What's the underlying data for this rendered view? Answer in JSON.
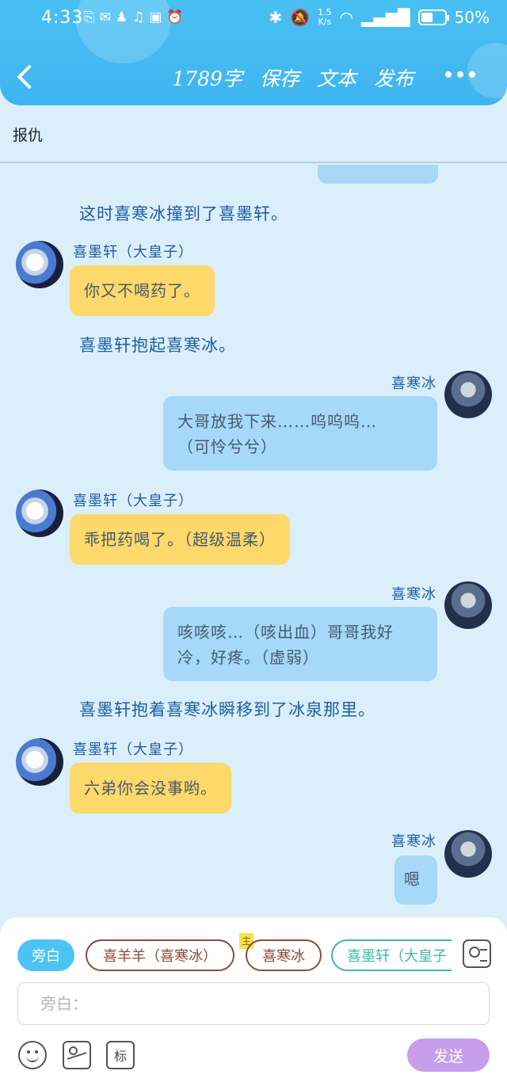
{
  "status": {
    "time": "4:33",
    "net_speed": "1.5\nK/s",
    "battery": "50%",
    "battery_level": 0.5
  },
  "toolbar": {
    "word_count": "1789字",
    "save": "保存",
    "text": "文本",
    "publish": "发布"
  },
  "title": "报仇",
  "chat": {
    "narration_1": "这时喜寒冰撞到了喜墨轩。",
    "speaker_xmx": "喜墨轩（大皇子）",
    "msg_1": "你又不喝药了。",
    "narration_2": "喜墨轩抱起喜寒冰。",
    "speaker_xhb": "喜寒冰",
    "msg_2_line1": "大哥放我下来……呜呜呜…",
    "msg_2_line2": "（可怜兮兮）",
    "msg_3": "乖把药喝了。（超级温柔）",
    "msg_4_line1": "咳咳咳…（咳出血）哥哥我好",
    "msg_4_line2": "冷，好疼。（虚弱）",
    "narration_3": "喜墨轩抱着喜寒冰瞬移到了冰泉那里。",
    "msg_5": "六弟你会没事哟。",
    "msg_6": "嗯"
  },
  "roles": {
    "narration": "旁白",
    "role_1": "喜羊羊（喜寒冰）",
    "main_tag": "主",
    "role_2": "喜寒冰",
    "role_3": "喜墨轩（大皇子"
  },
  "input": {
    "placeholder": "旁白："
  },
  "tools": {
    "mark": "标",
    "send": "发送"
  }
}
